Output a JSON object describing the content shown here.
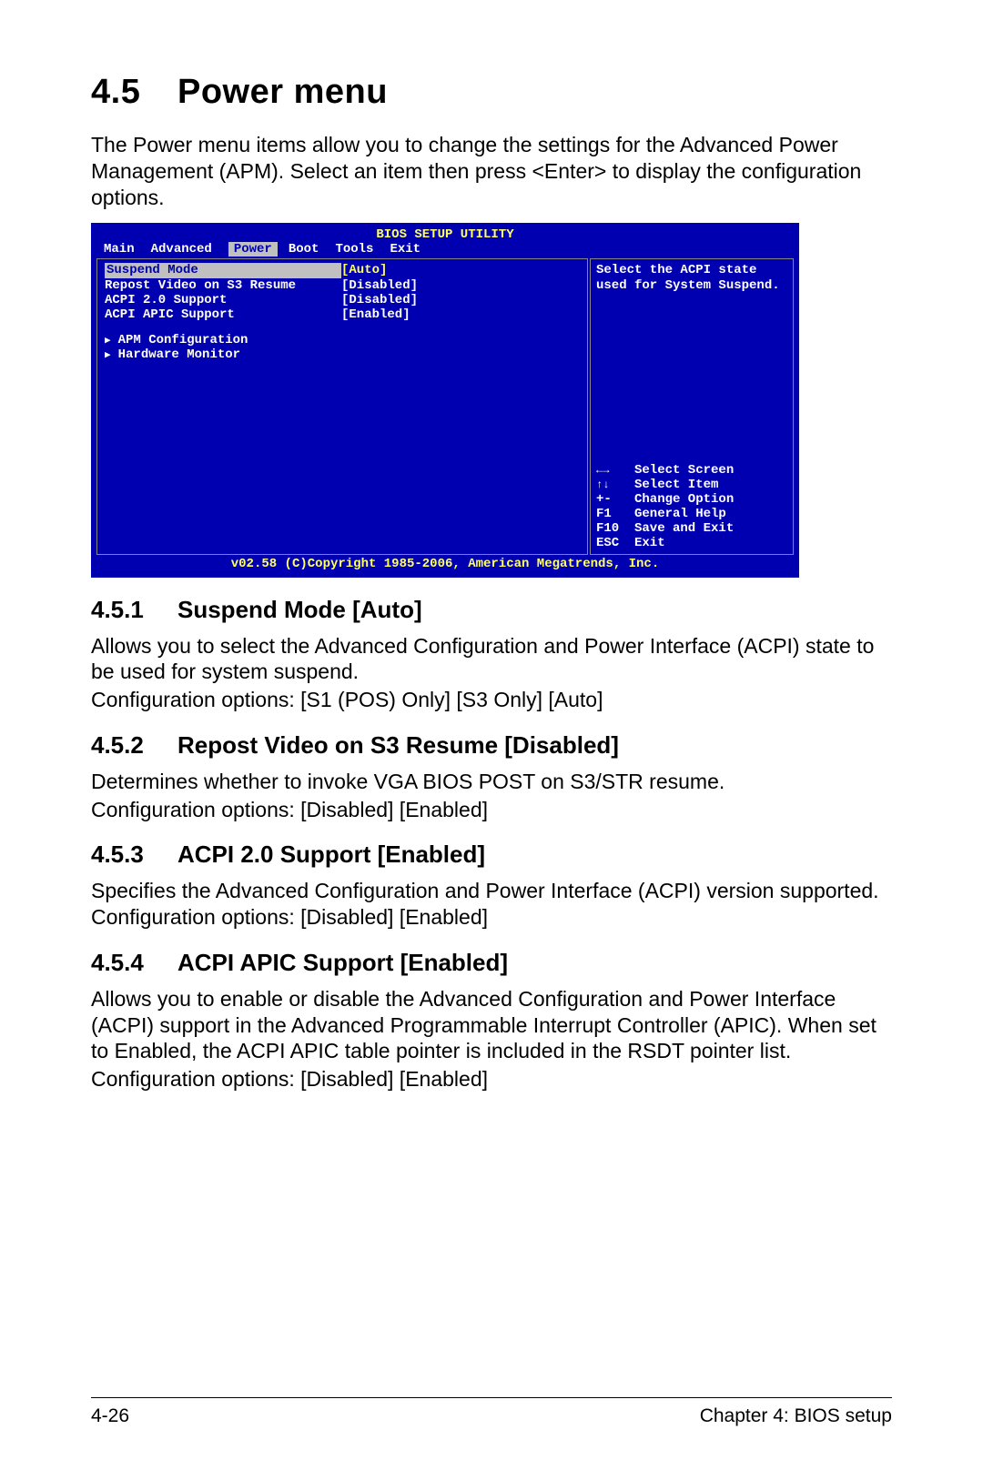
{
  "section": {
    "number": "4.5",
    "title": "Power menu",
    "intro": "The Power menu items allow you to change the settings for the Advanced Power Management (APM). Select an item then press <Enter> to display the configuration options."
  },
  "bios": {
    "title": "BIOS SETUP UTILITY",
    "tabs": [
      "Main",
      "Advanced",
      "Power",
      "Boot",
      "Tools",
      "Exit"
    ],
    "active_tab": "Power",
    "items": [
      {
        "label": "Suspend Mode",
        "value": "[Auto]",
        "selected": true
      },
      {
        "label": "Repost Video on S3 Resume",
        "value": "[Disabled]",
        "selected": false
      },
      {
        "label": "ACPI 2.0 Support",
        "value": "[Disabled]",
        "selected": false
      },
      {
        "label": "ACPI APIC Support",
        "value": "[Enabled]",
        "selected": false
      }
    ],
    "submenus": [
      "APM Configuration",
      "Hardware Monitor"
    ],
    "help_text": "Select the ACPI state used for System Suspend.",
    "keys": [
      {
        "key": "lr",
        "text": "Select Screen"
      },
      {
        "key": "ud",
        "text": "Select Item"
      },
      {
        "key": "+-",
        "text": "Change Option"
      },
      {
        "key": "F1",
        "text": "General Help"
      },
      {
        "key": "F10",
        "text": "Save and Exit"
      },
      {
        "key": "ESC",
        "text": "Exit"
      }
    ],
    "footer": "v02.58 (C)Copyright 1985-2006, American Megatrends, Inc."
  },
  "subsections": [
    {
      "number": "4.5.1",
      "title": "Suspend Mode [Auto]",
      "body1": "Allows you to select the Advanced Configuration and Power Interface (ACPI) state to be used for system suspend.",
      "body2": "Configuration options: [S1 (POS) Only] [S3 Only] [Auto]"
    },
    {
      "number": "4.5.2",
      "title": "Repost Video on S3 Resume [Disabled]",
      "body1": "Determines whether to invoke VGA BIOS POST on S3/STR resume.",
      "body2": "Configuration options: [Disabled] [Enabled]"
    },
    {
      "number": "4.5.3",
      "title": "ACPI 2.0 Support [Enabled]",
      "body1": "Specifies the Advanced Configuration and Power Interface (ACPI) version supported. Configuration options: [Disabled] [Enabled]",
      "body2": ""
    },
    {
      "number": "4.5.4",
      "title": "ACPI APIC Support [Enabled]",
      "body1": "Allows you to enable or disable the Advanced Configuration and Power Interface (ACPI) support in the Advanced Programmable Interrupt Controller (APIC). When set to Enabled, the ACPI APIC table pointer is included in the RSDT pointer list.",
      "body2": "Configuration options: [Disabled] [Enabled]"
    }
  ],
  "footer": {
    "left": "4-26",
    "right": "Chapter 4: BIOS setup"
  }
}
